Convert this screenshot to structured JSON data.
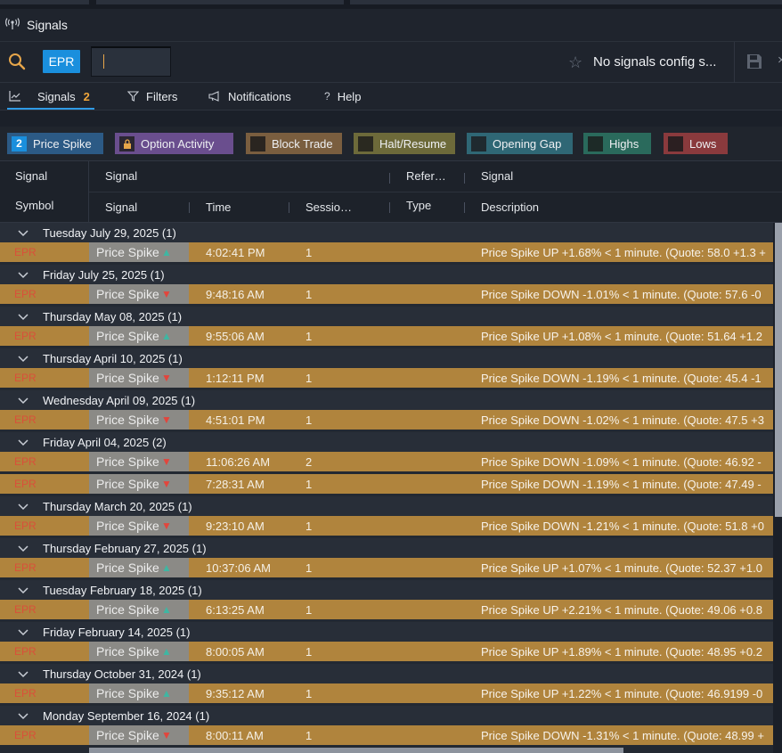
{
  "window": {
    "title": "Signals",
    "title_icon": "signal-broadcast-icon"
  },
  "toolbar": {
    "symbol_badge": "EPR",
    "symbol_input_value": "",
    "config_label": "No signals config s...",
    "accent": "#1a8fdd"
  },
  "tabs": [
    {
      "label": "Signals",
      "count": "2",
      "icon": "chart-line-icon",
      "active": true
    },
    {
      "label": "Filters",
      "icon": "filter-icon"
    },
    {
      "label": "Notifications",
      "icon": "megaphone-icon"
    },
    {
      "label": "Help",
      "icon": "question-icon"
    }
  ],
  "filters": [
    {
      "label": "Price Spike",
      "badge": "2",
      "color": "#2c5a85",
      "box": "#1a8fdd"
    },
    {
      "label": "Option Activity",
      "badge": "lock",
      "color": "#6a4e8e",
      "box": "#2b2632"
    },
    {
      "label": "Block Trade",
      "color": "#7a5e3f",
      "box": "#2a2520"
    },
    {
      "label": "Halt/Resume",
      "color": "#6d6a3a",
      "box": "#2a2920"
    },
    {
      "label": "Opening Gap",
      "color": "#2f6775",
      "box": "#1f2a2f"
    },
    {
      "label": "Highs",
      "color": "#2a6a5c",
      "box": "#1d2a27"
    },
    {
      "label": "Lows",
      "color": "#8a3a3d",
      "box": "#2b1f21"
    }
  ],
  "header": {
    "row1": {
      "signal_symbol": "Signal",
      "signal": "Signal",
      "reference": "Refer…",
      "description": "Signal"
    },
    "row2": {
      "symbol": "Symbol",
      "signal": "Signal",
      "time": "Time",
      "session": "Sessio…",
      "type": "Type",
      "description": "Description"
    }
  },
  "groups": [
    {
      "label": "Tuesday July 29, 2025 (1)",
      "rows": [
        {
          "symbol": "EPR",
          "signal": "Price Spike",
          "dir": "up",
          "time": "4:02:41 PM",
          "session": "1",
          "desc": "Price Spike UP +1.68% < 1 minute. (Quote: 58.0 +1.3 +"
        }
      ]
    },
    {
      "label": "Friday July 25, 2025 (1)",
      "rows": [
        {
          "symbol": "EPR",
          "signal": "Price Spike",
          "dir": "down",
          "time": "9:48:16 AM",
          "session": "1",
          "desc": "Price Spike DOWN -1.01% < 1 minute. (Quote: 57.6 -0"
        }
      ]
    },
    {
      "label": "Thursday May 08, 2025 (1)",
      "rows": [
        {
          "symbol": "EPR",
          "signal": "Price Spike",
          "dir": "up",
          "time": "9:55:06 AM",
          "session": "1",
          "desc": "Price Spike UP +1.08% < 1 minute. (Quote: 51.64 +1.2"
        }
      ]
    },
    {
      "label": "Thursday April 10, 2025 (1)",
      "rows": [
        {
          "symbol": "EPR",
          "signal": "Price Spike",
          "dir": "down",
          "time": "1:12:11 PM",
          "session": "1",
          "desc": "Price Spike DOWN -1.19% < 1 minute. (Quote: 45.4 -1"
        }
      ]
    },
    {
      "label": "Wednesday April 09, 2025 (1)",
      "rows": [
        {
          "symbol": "EPR",
          "signal": "Price Spike",
          "dir": "down",
          "time": "4:51:01 PM",
          "session": "1",
          "desc": "Price Spike DOWN -1.02% < 1 minute. (Quote: 47.5 +3"
        }
      ]
    },
    {
      "label": "Friday April 04, 2025 (2)",
      "rows": [
        {
          "symbol": "EPR",
          "signal": "Price Spike",
          "dir": "down",
          "time": "11:06:26 AM",
          "session": "2",
          "desc": "Price Spike DOWN -1.09% < 1 minute. (Quote: 46.92 -"
        },
        {
          "symbol": "EPR",
          "signal": "Price Spike",
          "dir": "down",
          "time": "7:28:31 AM",
          "session": "1",
          "desc": "Price Spike DOWN -1.19% < 1 minute. (Quote: 47.49 -"
        }
      ]
    },
    {
      "label": "Thursday March 20, 2025 (1)",
      "rows": [
        {
          "symbol": "EPR",
          "signal": "Price Spike",
          "dir": "down",
          "time": "9:23:10 AM",
          "session": "1",
          "desc": "Price Spike DOWN -1.21% < 1 minute. (Quote: 51.8 +0"
        }
      ]
    },
    {
      "label": "Thursday February 27, 2025 (1)",
      "rows": [
        {
          "symbol": "EPR",
          "signal": "Price Spike",
          "dir": "up",
          "time": "10:37:06 AM",
          "session": "1",
          "desc": "Price Spike UP +1.07% < 1 minute. (Quote: 52.37 +1.0"
        }
      ]
    },
    {
      "label": "Tuesday February 18, 2025 (1)",
      "rows": [
        {
          "symbol": "EPR",
          "signal": "Price Spike",
          "dir": "up",
          "time": "6:13:25 AM",
          "session": "1",
          "desc": "Price Spike UP +2.21% < 1 minute. (Quote: 49.06 +0.8"
        }
      ]
    },
    {
      "label": "Friday February 14, 2025 (1)",
      "rows": [
        {
          "symbol": "EPR",
          "signal": "Price Spike",
          "dir": "up",
          "time": "8:00:05 AM",
          "session": "1",
          "desc": "Price Spike UP +1.89% < 1 minute. (Quote: 48.95 +0.2"
        }
      ]
    },
    {
      "label": "Thursday October 31, 2024 (1)",
      "rows": [
        {
          "symbol": "EPR",
          "signal": "Price Spike",
          "dir": "up",
          "time": "9:35:12 AM",
          "session": "1",
          "desc": "Price Spike UP +1.22% < 1 minute. (Quote: 46.9199 -0"
        }
      ]
    },
    {
      "label": "Monday September 16, 2024 (1)",
      "rows": [
        {
          "symbol": "EPR",
          "signal": "Price Spike",
          "dir": "down",
          "time": "8:00:11 AM",
          "session": "1",
          "desc": "Price Spike DOWN -1.31% < 1 minute. (Quote: 48.99 +"
        }
      ]
    }
  ],
  "colors": {
    "row_bg": "#b0843d",
    "up_arrow": "#3fb6a2",
    "down_arrow": "#e2453c",
    "symbol_text": "#d9503a"
  }
}
